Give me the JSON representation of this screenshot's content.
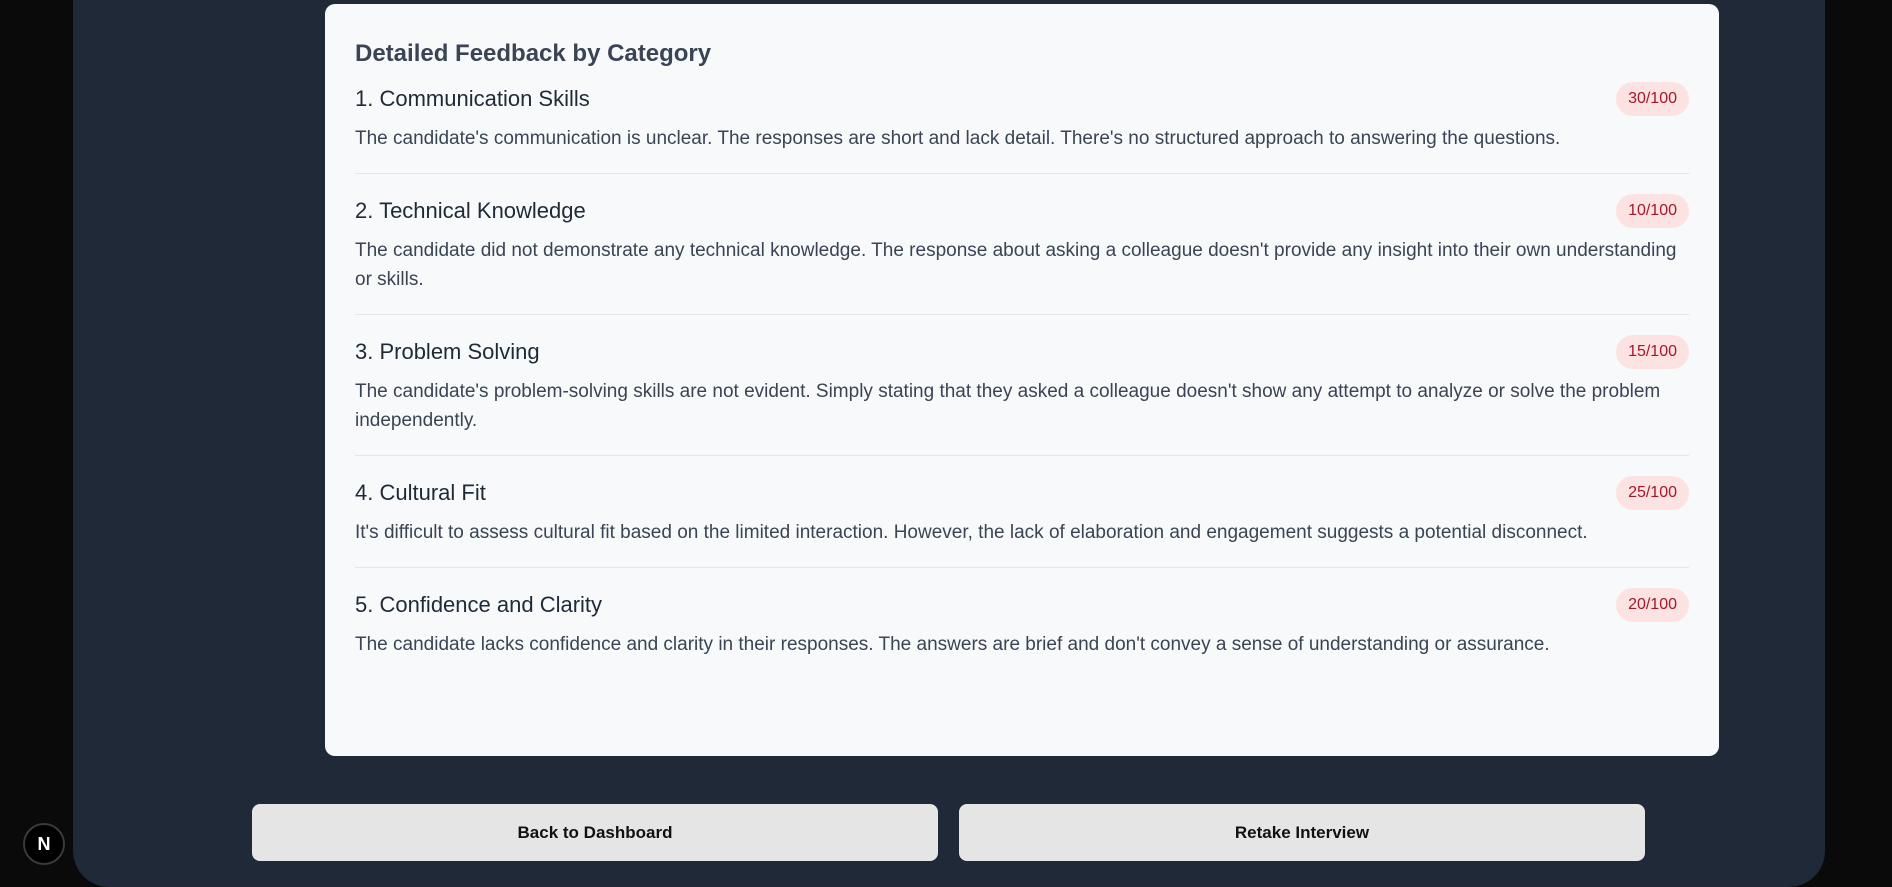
{
  "feedback": {
    "title": "Detailed Feedback by Category",
    "categories": [
      {
        "title": "1. Communication Skills",
        "score": "30/100",
        "description": "The candidate's communication is unclear. The responses are short and lack detail. There's no structured approach to answering the questions."
      },
      {
        "title": "2. Technical Knowledge",
        "score": "10/100",
        "description": "The candidate did not demonstrate any technical knowledge. The response about asking a colleague doesn't provide any insight into their own understanding or skills."
      },
      {
        "title": "3. Problem Solving",
        "score": "15/100",
        "description": "The candidate's problem-solving skills are not evident. Simply stating that they asked a colleague doesn't show any attempt to analyze or solve the problem independently."
      },
      {
        "title": "4. Cultural Fit",
        "score": "25/100",
        "description": "It's difficult to assess cultural fit based on the limited interaction. However, the lack of elaboration and engagement suggests a potential disconnect."
      },
      {
        "title": "5. Confidence and Clarity",
        "score": "20/100",
        "description": "The candidate lacks confidence and clarity in their responses. The answers are brief and don't convey a sense of understanding or assurance."
      }
    ]
  },
  "actions": {
    "back_label": "Back to Dashboard",
    "retake_label": "Retake Interview"
  },
  "dev_badge": {
    "label": "N",
    "icon": "nextjs-logo-icon"
  },
  "colors": {
    "page_background": "#0a0a0a",
    "shell_background": "#1f2937",
    "card_background": "#f8f9fb",
    "badge_background": "#fde2e2",
    "badge_text": "#a1182b",
    "button_background": "#e5e5e5"
  }
}
